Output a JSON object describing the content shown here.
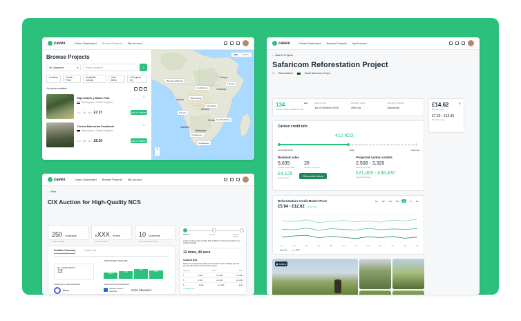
{
  "app": {
    "brand": "cavex",
    "nav": [
      "Cavex Dashboard",
      "Browse Projects",
      "My Account"
    ]
  },
  "browse": {
    "title": "Browse Projects",
    "category": "All Categories",
    "search_placeholder": "Search projects...",
    "filters": [
      "Location",
      "Credit Price",
      "Available credits",
      "View filters"
    ],
    "projects_btn": "Projects (4)",
    "count_text": "4 projects available",
    "projects": [
      {
        "name": "Rajo Dahiru y Baltic Park",
        "location": "Birmingham, United Kingdom",
        "price_from": "£4",
        "price": "£7.37",
        "cta": "Add to Basket"
      },
      {
        "name": "Central Bahvarian Peatlands",
        "location": "Birmingham, United Kingdom",
        "price_from": "£2",
        "price": "£8.20",
        "cta": "Add to Basket"
      }
    ],
    "map": {
      "tabs": [
        "Map",
        "Satellite"
      ],
      "countries": [
        "Kenya",
        "Tanzania",
        "Angola",
        "Zambia",
        "Namibia",
        "Botswana",
        "Zimbabwe"
      ],
      "labels": [
        "Biomass Methods",
        "Forestry",
        "Cookstoves",
        "Agriculture",
        "Fuel Switching",
        "Forestry",
        "Cookstoves",
        "Solar Energy",
        "Cookstoves"
      ]
    }
  },
  "safaricom": {
    "back": "Back to Projects",
    "title": "Safaricom Reforestation Project",
    "tag1": "Reforestation",
    "tag2": "South Marmaroi, Kenya",
    "stats": [
      {
        "label": "Carbon credits available for sale",
        "value": "134"
      },
      {
        "label": "Start date",
        "value": "1st of October 2019"
      },
      {
        "label": "Project area",
        "value": "3000 ha"
      },
      {
        "label": "Project owner",
        "value": "Safaricom"
      }
    ],
    "edit": "Edit",
    "buy_price": "£14.62",
    "buy_label": "Buy Now price",
    "range": "£7.23 - £13.95",
    "range_label": "Bid price range",
    "carbon_title": "Carbon credit info",
    "total": "412 tCO₂",
    "timeline": [
      "1st October 2019",
      "Today",
      "Year 2 est."
    ],
    "realised_title": "Realised sales",
    "r1": "5,635",
    "r1l": "Credits sold to date",
    "r2": "26",
    "r2l": "Number of buyers",
    "r3": "£4,125",
    "r3l": "Total revenue",
    "show_btn": "Show sales history",
    "projected_title": "Projected carbon credits",
    "p1": "2,508 - 3,320",
    "p1l": "Estimated credits",
    "p2": "£21,400 - £36,430",
    "p2l": "Potential revenue",
    "market_title": "Reforestation Credit Market Price",
    "market_range": "£5.94 - £12.62",
    "market_change": "+3.4% (7d)",
    "periods": [
      "1D",
      "1W",
      "1M",
      "3M",
      "6M",
      "1Y",
      "All"
    ],
    "legend": [
      "Low",
      "High"
    ],
    "photo_badge": "Gallery"
  },
  "chart_data": {
    "type": "line",
    "title": "Reforestation Credit Market Price",
    "x": [
      "Jan",
      "Feb",
      "Mar",
      "Apr",
      "May",
      "Jun",
      "Jul",
      "Aug",
      "Sep",
      "Oct",
      "Nov",
      "Dec"
    ],
    "series": [
      {
        "name": "High",
        "values": [
          12.1,
          11.8,
          12.4,
          11.5,
          11.9,
          12.2,
          11.7,
          12.0,
          11.6,
          12.3,
          12.0,
          12.6
        ]
      },
      {
        "name": "Low",
        "values": [
          9.2,
          9.0,
          9.6,
          8.8,
          9.4,
          9.1,
          8.9,
          9.5,
          9.0,
          9.3,
          9.1,
          9.4
        ]
      },
      {
        "name": "Low",
        "values": [
          6.5,
          6.9,
          7.1,
          6.2,
          6.8,
          6.4,
          6.0,
          6.6,
          6.3,
          6.7,
          6.1,
          6.5
        ]
      }
    ],
    "ylim": [
      5,
      14
    ]
  },
  "auction": {
    "back": "Back",
    "title": "CIX Auction for High-Quality NCS",
    "s1": "250",
    "s1u": "contracts",
    "s1l": "Auction Supply",
    "s2": "XXX",
    "s2p": "£",
    "s2u": "/tonne",
    "s2l": "Reserve Price",
    "s3": "10",
    "s3u": "contracts",
    "s3l": "Minimum Bid Quantity",
    "tabs": [
      "Portfolio Summary",
      "Project List"
    ],
    "num_projects_label": "NO. OF PROJECTS",
    "num_projects": "12",
    "vintages_label": "CONSTITUENT VINTAGES",
    "vintages": [
      "2018",
      "2019",
      "2020",
      "2021"
    ],
    "geo_label": "PORTFOLIO GEOGRAPHIES",
    "geo_value": "Africa",
    "verif_label": "VERIFICATION STANDARDS",
    "verra": "Verified Carbon Standard",
    "gold": "Gold Standard",
    "steps": [
      "Round 1",
      "Round 2",
      "Auction Closes"
    ],
    "round_note": "In this round you have until the 15th of March to submit your bid for your selected quantity",
    "time": "12 mins, 44 secs",
    "submit": "Submit Bid",
    "submit_note": "Please set your desired quantity and a bid price. After submitting your bid, you can edit it before the close of this round.",
    "table_head": [
      "Quantity",
      "Price",
      "Total"
    ],
    "table_rows": [
      [
        "5",
        "4,534",
        "£ 1,000",
        "£ 1,532"
      ],
      [
        "5",
        "4,534",
        "£ 1,000",
        "£ 1,000"
      ],
      [
        "5",
        "4,534",
        "£ 1,000",
        "£ 25"
      ]
    ],
    "add_link": "+ Add Bid Line"
  }
}
